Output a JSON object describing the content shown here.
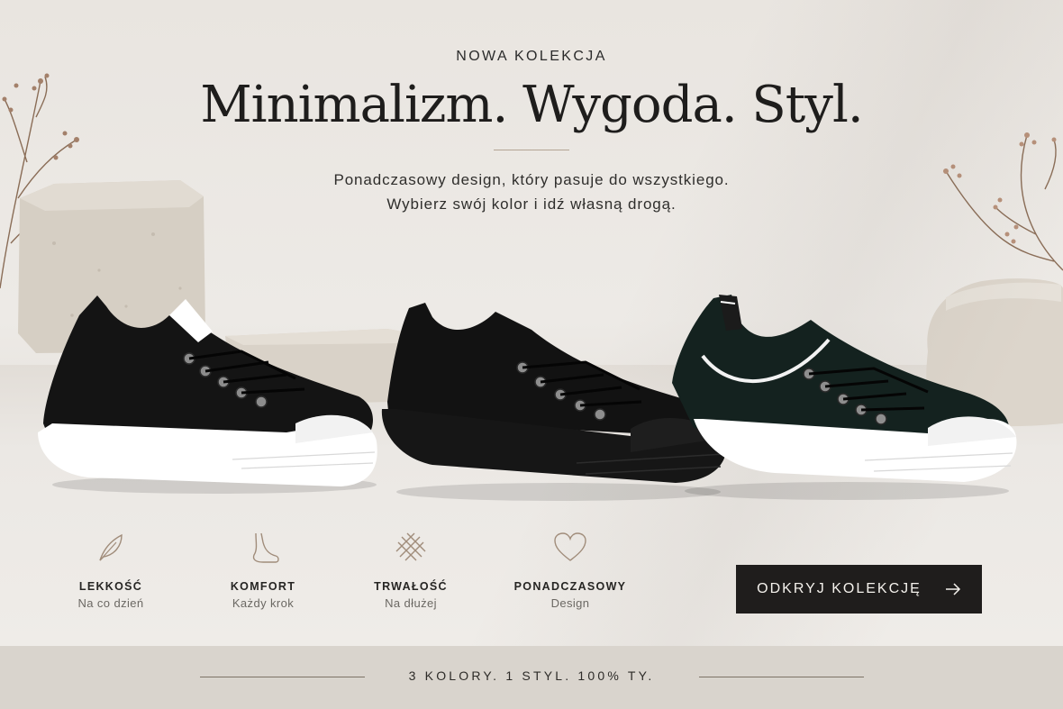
{
  "header": {
    "eyebrow": "NOWA KOLEKCJA",
    "headline": "Minimalizm. Wygoda. Styl.",
    "subline_1": "Ponadczasowy design, który pasuje do wszystkiego.",
    "subline_2": "Wybierz swój kolor i idź własną drogą."
  },
  "products": [
    {
      "name": "black-knit-sneaker-white-sole",
      "upper": "#141414",
      "sole": "#ffffff"
    },
    {
      "name": "all-black-knit-sneaker",
      "upper": "#111111",
      "sole": "#151515"
    },
    {
      "name": "dark-green-knit-sneaker-white-sole",
      "upper": "#142420",
      "sole": "#ffffff"
    }
  ],
  "features": [
    {
      "icon": "feather-icon",
      "title": "LEKKOŚĆ",
      "subtitle": "Na co dzień"
    },
    {
      "icon": "foot-icon",
      "title": "KOMFORT",
      "subtitle": "Każdy krok"
    },
    {
      "icon": "weave-icon",
      "title": "TRWAŁOŚĆ",
      "subtitle": "Na dłużej"
    },
    {
      "icon": "heart-icon",
      "title": "PONADCZASOWY",
      "subtitle": "Design"
    }
  ],
  "cta": {
    "label": "ODKRYJ KOLEKCJĘ",
    "icon": "arrow-right-icon"
  },
  "footer_strip": {
    "text": "3 KOLORY. 1 STYL. 100% TY."
  },
  "colors": {
    "accent_line": "#b3a494",
    "cta_bg": "#1f1d1c",
    "icon_stroke": "#a08c7a",
    "background": "#ece8e3"
  }
}
